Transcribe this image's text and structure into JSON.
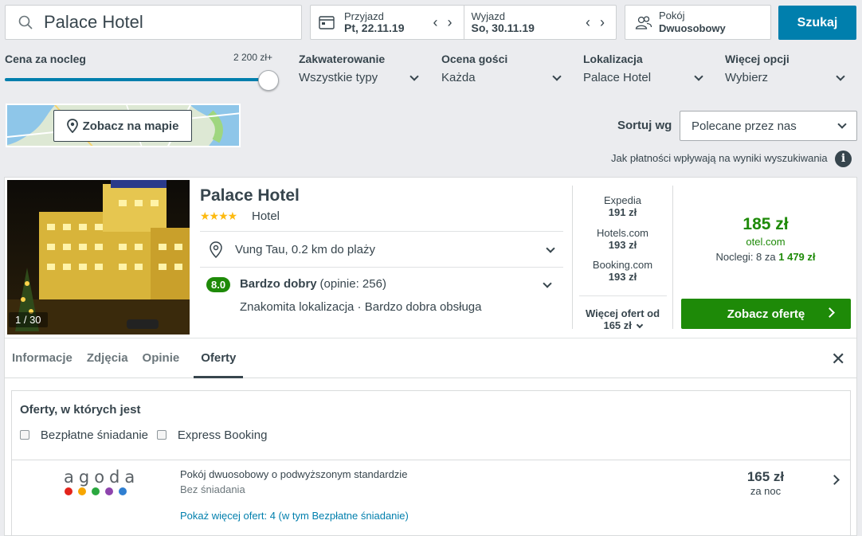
{
  "search": {
    "value": "Palace Hotel"
  },
  "checkin": {
    "label": "Przyjazd",
    "value": "Pt, 22.11.19"
  },
  "checkout": {
    "label": "Wyjazd",
    "value": "So, 30.11.19"
  },
  "room": {
    "label": "Pokój",
    "value": "Dwuosobowy"
  },
  "search_button": "Szukaj",
  "filters": {
    "price": {
      "label": "Cena za nocleg",
      "max": "2 200 zł+",
      "level_percent": 100
    },
    "accommodation": {
      "label": "Zakwaterowanie",
      "value": "Wszystkie typy"
    },
    "rating": {
      "label": "Ocena gości",
      "value": "Każda"
    },
    "location": {
      "label": "Lokalizacja",
      "value": "Palace Hotel"
    },
    "more": {
      "label": "Więcej opcji",
      "value": "Wybierz"
    }
  },
  "map_button": "Zobacz na mapie",
  "sort": {
    "label": "Sortuj wg",
    "value": "Polecane przez nas"
  },
  "payment_info": "Jak płatności wpływają na wyniki wyszukiwania",
  "hotel": {
    "photo_counter": "1 / 30",
    "name": "Palace Hotel",
    "stars": "★★★★",
    "type": "Hotel",
    "location": "Vung Tau, 0.2 km do plaży",
    "rating_score": "8.0",
    "rating_text": "Bardzo dobry",
    "rating_count": "(opinie: 256)",
    "highlights": "Znakomita lokalizacja · Bardzo dobra obsługa"
  },
  "prices": [
    {
      "site": "Expedia",
      "price": "191 zł"
    },
    {
      "site": "Hotels.com",
      "price": "193 zł"
    },
    {
      "site": "Booking.com",
      "price": "193 zł"
    }
  ],
  "more_offers": {
    "line1": "Więcej ofert od",
    "line2": "165 zł"
  },
  "best_deal": {
    "price": "185 zł",
    "site": "otel.com",
    "nights_prefix": "Noclegi: 8 za",
    "nights_total": "1 479 zł",
    "button": "Zobacz ofertę"
  },
  "tabs": [
    "Informacje",
    "Zdjęcia",
    "Opinie",
    "Oferty"
  ],
  "offers": {
    "title": "Oferty, w których jest",
    "checkboxes": [
      "Bezpłatne śniadanie",
      "Express Booking"
    ],
    "row": {
      "provider": "agoda",
      "room": "Pokój dwuosobowy o podwyższonym standardzie",
      "meal": "Bez śniadania",
      "more_link": "Pokaż więcej ofert: 4 (w tym Bezpłatne śniadanie)",
      "price": "165 zł",
      "per": "za noc"
    }
  },
  "colors": {
    "accent": "#007fad",
    "deal_green": "#1e8a08",
    "text": "#37454d"
  }
}
